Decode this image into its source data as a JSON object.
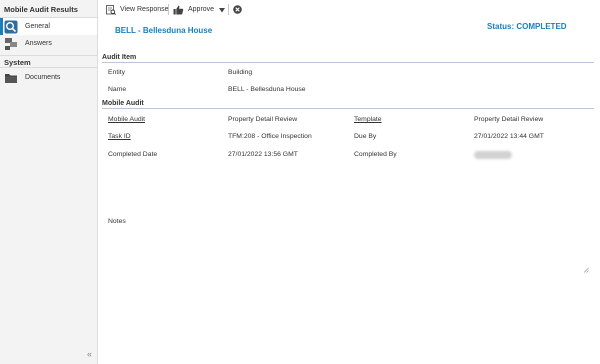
{
  "sidebar": {
    "header": "Mobile Audit Results",
    "items": [
      {
        "label": "General",
        "icon": "search-icon",
        "active": true
      },
      {
        "label": "Answers",
        "icon": "answers-icon",
        "active": false
      }
    ],
    "section": "System",
    "section_items": [
      {
        "label": "Documents",
        "icon": "folder-icon"
      }
    ],
    "collapse_glyph": "«"
  },
  "toolbar": {
    "view_response": "View Response",
    "approve": "Approve"
  },
  "header": {
    "title": "BELL - Bellesduna House",
    "status": "Status: COMPLETED"
  },
  "audit_item": {
    "title": "Audit Item",
    "entity_label": "Entity",
    "entity_value": "Building",
    "name_label": "Name",
    "name_value": "BELL - Bellesduna House"
  },
  "mobile_audit": {
    "title": "Mobile Audit",
    "mobile_audit_label": "Mobile Audit",
    "mobile_audit_value": "Property Detail Review",
    "template_label": "Template",
    "template_value": "Property Detail Review",
    "task_id_label": "Task ID",
    "task_id_value": "TFM:208 - Office Inspection",
    "due_by_label": "Due By",
    "due_by_value": "27/01/2022 13:44 GMT",
    "completed_date_label": "Completed Date",
    "completed_date_value": "27/01/2022 13:56 GMT",
    "completed_by_label": "Completed By"
  },
  "notes": {
    "label": "Notes"
  },
  "colors": {
    "accent": "#1a7ebd",
    "sidebar_bg": "#f3f3f3"
  }
}
